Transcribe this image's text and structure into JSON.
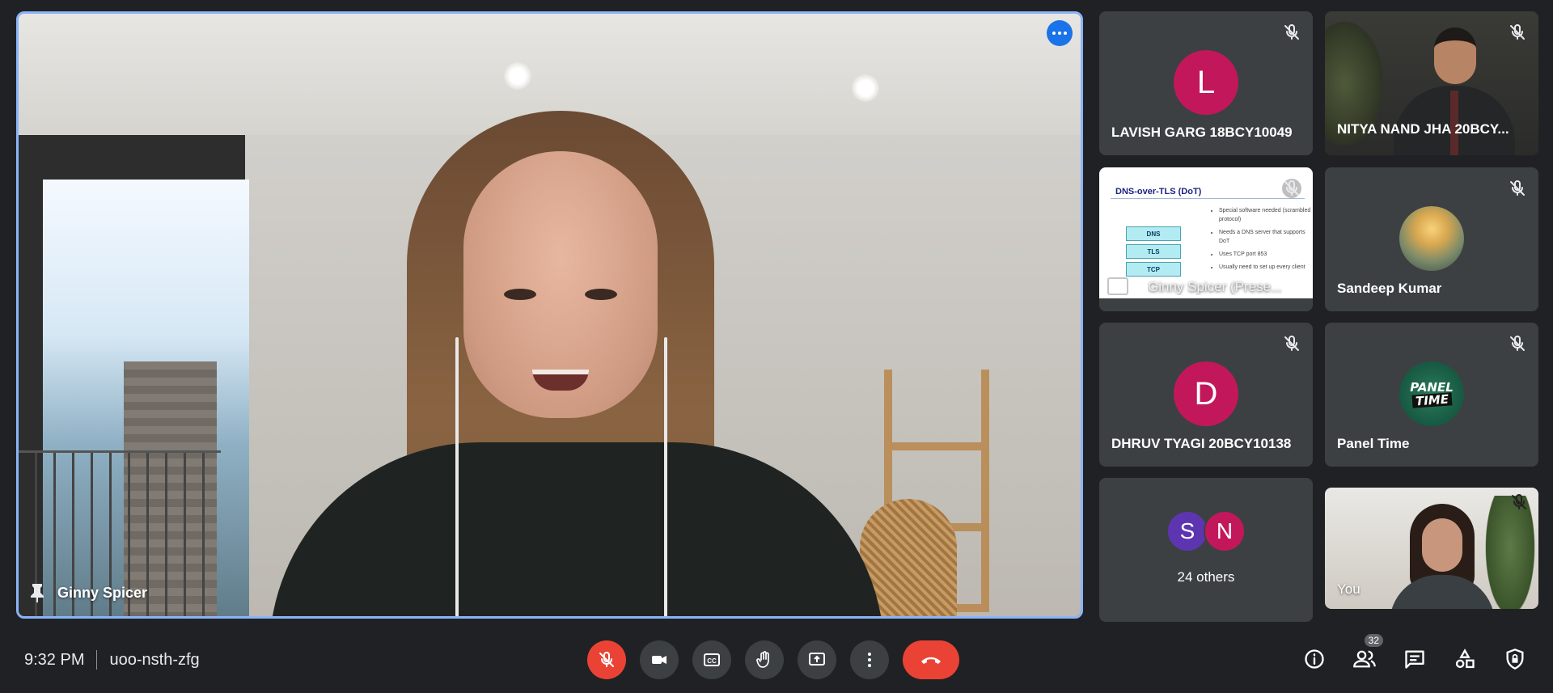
{
  "main_speaker": {
    "name": "Ginny Spicer"
  },
  "tiles": {
    "lavish": {
      "initial": "L",
      "name": "LAVISH GARG 18BCY10049",
      "avatar_color": "#c2185b"
    },
    "nitya": {
      "name": "NITYA NAND JHA 20BCY..."
    },
    "presentation": {
      "name": "Ginny Spicer (Prese...",
      "slide_title": "DNS-over-TLS (DoT)",
      "stack": [
        "DNS",
        "TLS",
        "TCP"
      ],
      "bullets": [
        "Special software needed (scrambled protocol)",
        "Needs a DNS server that supports DoT",
        "Uses TCP port 853",
        "Usually need to set up every client"
      ]
    },
    "sandeep": {
      "name": "Sandeep Kumar"
    },
    "dhruv": {
      "initial": "D",
      "name": "DHRUV TYAGI 20BCY10138",
      "avatar_color": "#c2185b"
    },
    "panel": {
      "name": "Panel Time",
      "logo_line1": "PANEL",
      "logo_line2": "TIME"
    },
    "others": {
      "label": "24 others",
      "avatars": [
        {
          "initial": "S",
          "color": "#5e35b1"
        },
        {
          "initial": "N",
          "color": "#c2185b"
        }
      ]
    },
    "you": {
      "name": "You"
    }
  },
  "bottom_bar": {
    "time": "9:32 PM",
    "meeting_code": "uoo-nsth-zfg",
    "participant_count": "32"
  },
  "colors": {
    "background": "#202124",
    "tile": "#3c4043",
    "active_border": "#8ab4f8",
    "danger": "#ea4335",
    "accent": "#1a73e8"
  }
}
